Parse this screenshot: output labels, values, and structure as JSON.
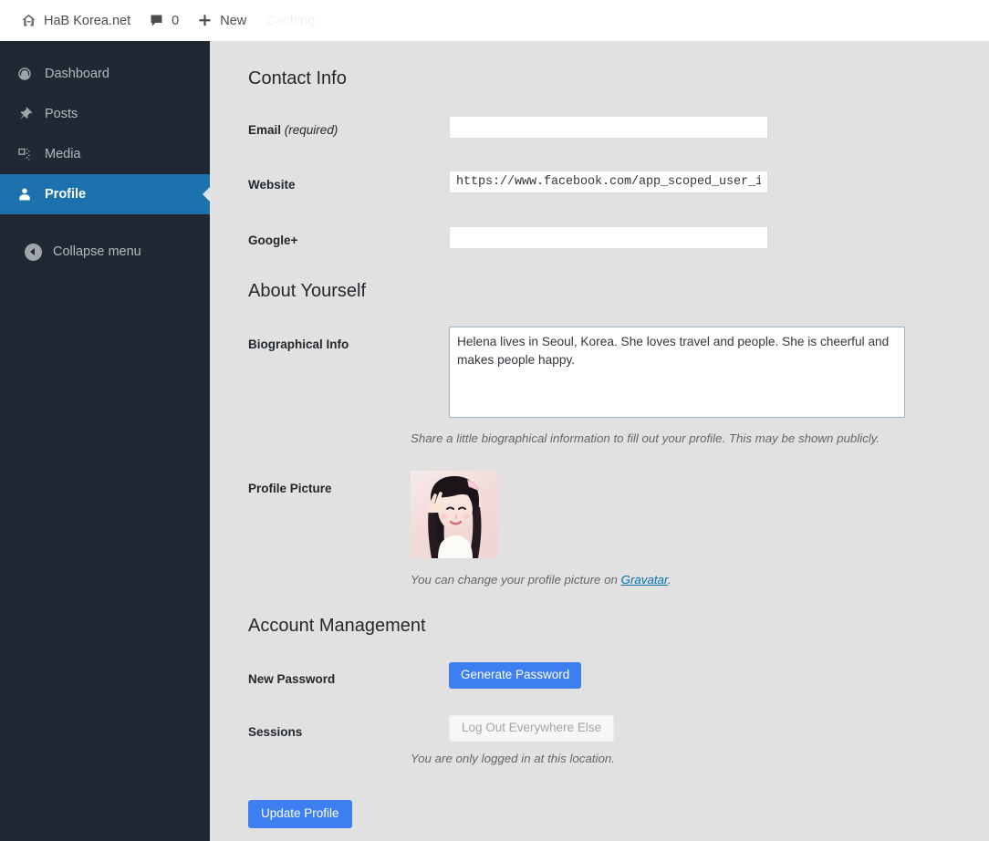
{
  "adminbar": {
    "site_icon": "home-icon",
    "site_name": "HaB Korea.net",
    "comments_icon": "comment-bubble-icon",
    "comments_count": "0",
    "new_icon": "plus-icon",
    "new_label": "New",
    "caching_label": "Caching"
  },
  "sidebar": {
    "items": [
      {
        "label": "Dashboard",
        "icon": "dashboard-gauge-icon",
        "current": false
      },
      {
        "label": "Posts",
        "icon": "pin-icon",
        "current": false
      },
      {
        "label": "Media",
        "icon": "media-photos-icon",
        "current": false
      },
      {
        "label": "Profile",
        "icon": "user-icon",
        "current": true
      }
    ],
    "collapse": {
      "label": "Collapse menu",
      "icon": "chevron-left-circle-icon"
    }
  },
  "main": {
    "contact_info": {
      "heading": "Contact Info",
      "email": {
        "label": "Email",
        "required_note": "(required)",
        "value": "",
        "placeholder": ""
      },
      "website": {
        "label": "Website",
        "value": "https://www.facebook.com/app_scoped_user_id/",
        "placeholder": ""
      },
      "googleplus": {
        "label": "Google+",
        "value": "",
        "placeholder": ""
      }
    },
    "about_yourself": {
      "heading": "About Yourself",
      "bio": {
        "label": "Biographical Info",
        "value": "Helena lives in Seoul, Korea. She loves travel and people. She is cheerful and makes people happy.",
        "description": "Share a little biographical information to fill out your profile. This may be shown publicly."
      },
      "profile_picture": {
        "label": "Profile Picture",
        "description_prefix": "You can change your profile picture on ",
        "link_label": "Gravatar",
        "description_suffix": "."
      }
    },
    "account_management": {
      "heading": "Account Management",
      "new_password": {
        "label": "New Password",
        "button_label": "Generate Password"
      },
      "sessions": {
        "label": "Sessions",
        "button_label": "Log Out Everywhere Else",
        "description": "You are only logged in at this location."
      }
    },
    "submit": {
      "label": "Update Profile"
    }
  },
  "colors": {
    "accent_blue": "#3d7ef0",
    "menu_current_blue": "#1c72ac",
    "sidebar_bg": "#1f2833",
    "content_bg": "#e1e1e1",
    "link_blue": "#0073aa"
  }
}
